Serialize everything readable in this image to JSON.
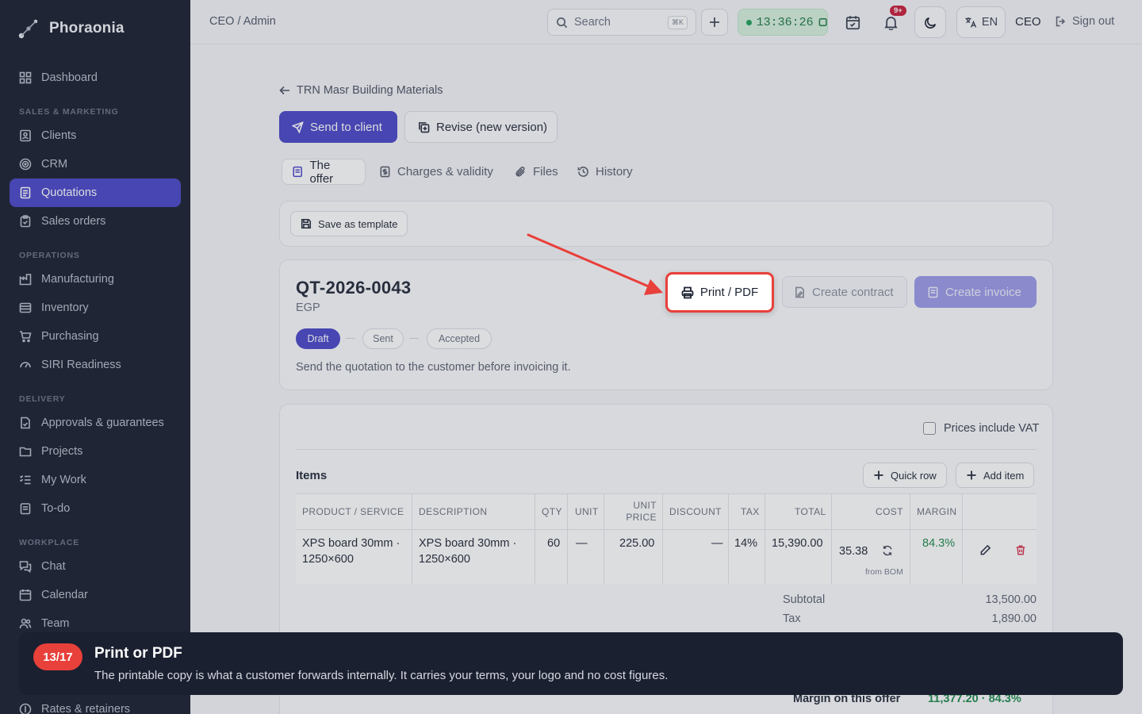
{
  "brand": {
    "name": "Phoraonia"
  },
  "sidebar": {
    "sections": {
      "sales": "SALES & MARKETING",
      "operations": "OPERATIONS",
      "delivery": "DELIVERY",
      "workplace": "WORKPLACE"
    },
    "items": [
      {
        "label": "Dashboard",
        "icon": "grid-icon"
      },
      {
        "label": "Clients",
        "icon": "contact-icon"
      },
      {
        "label": "CRM",
        "icon": "target-icon"
      },
      {
        "label": "Quotations",
        "icon": "document-icon"
      },
      {
        "label": "Sales orders",
        "icon": "clipboard-icon"
      },
      {
        "label": "Manufacturing",
        "icon": "factory-icon"
      },
      {
        "label": "Inventory",
        "icon": "box-icon"
      },
      {
        "label": "Purchasing",
        "icon": "cart-icon"
      },
      {
        "label": "SIRI Readiness",
        "icon": "gauge-icon"
      },
      {
        "label": "Approvals & guarantees",
        "icon": "file-check-icon"
      },
      {
        "label": "Projects",
        "icon": "folder-icon"
      },
      {
        "label": "My Work",
        "icon": "list-check-icon"
      },
      {
        "label": "To-do",
        "icon": "todo-icon"
      },
      {
        "label": "Chat",
        "icon": "chat-icon"
      },
      {
        "label": "Calendar",
        "icon": "calendar-icon"
      },
      {
        "label": "Team",
        "icon": "team-icon"
      },
      {
        "label": "Rates & retainers",
        "icon": "rates-icon"
      }
    ]
  },
  "topbar": {
    "breadcrumb": "CEO / Admin",
    "search_placeholder": "Search",
    "search_shortcut": "⌘K",
    "timer": "13:36:26",
    "notifications_badge": "9+",
    "language": "EN",
    "role": "CEO",
    "signout": "Sign out"
  },
  "page": {
    "back_label": "TRN Masr Building Materials",
    "send_label": "Send to client",
    "revise_label": "Revise (new version)",
    "tabs": [
      "The offer",
      "Charges & validity",
      "Files",
      "History"
    ],
    "save_template": "Save as template",
    "quote_number": "QT-2026-0043",
    "currency": "EGP",
    "statuses": [
      "Draft",
      "Sent",
      "Accepted"
    ],
    "hint": "Send the quotation to the customer before invoicing it.",
    "print_label": "Print / PDF",
    "contract_label": "Create contract",
    "invoice_label": "Create invoice"
  },
  "items": {
    "vat_label": "Prices include VAT",
    "title": "Items",
    "quick_row": "Quick row",
    "add_item": "Add item",
    "headers": [
      "PRODUCT / SERVICE",
      "DESCRIPTION",
      "QTY",
      "UNIT",
      "UNIT PRICE",
      "DISCOUNT",
      "TAX",
      "TOTAL",
      "COST",
      "MARGIN"
    ],
    "row": {
      "product": "XPS board 30mm · 1250×600",
      "description": "XPS board 30mm · 1250×600",
      "qty": "60",
      "unit": "—",
      "unit_price": "225.00",
      "discount": "—",
      "tax": "14%",
      "total": "15,390.00",
      "cost": "35.38",
      "cost_note": "from BOM",
      "margin": "84.3%"
    },
    "subtotal_label": "Subtotal",
    "subtotal": "13,500.00",
    "tax_label": "Tax",
    "tax": "1,890.00",
    "margin_label": "Margin on this offer",
    "margin_value": "11,377.20 · 84.3%"
  },
  "tour": {
    "step": "13/17",
    "title": "Print or PDF",
    "body": "The printable copy is what a customer forwards internally. It carries your terms, your logo and no cost figures."
  },
  "colors": {
    "accent": "#4a47c9",
    "highlight": "#e8403a",
    "success": "#1f7a44"
  }
}
